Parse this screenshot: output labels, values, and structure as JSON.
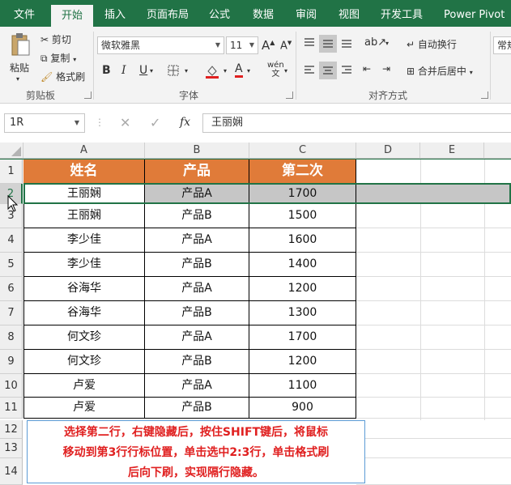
{
  "tabs": [
    "文件",
    "开始",
    "插入",
    "页面布局",
    "公式",
    "数据",
    "审阅",
    "视图",
    "开发工具",
    "Power Pivot"
  ],
  "ribbon": {
    "clipboard": {
      "paste": "粘贴",
      "cut": "剪切",
      "copy": "复制",
      "format_painter": "格式刷",
      "group": "剪贴板"
    },
    "font": {
      "name": "微软雅黑",
      "size": "11",
      "bold": "B",
      "italic": "I",
      "underline": "U",
      "grow": "A",
      "shrink": "A",
      "phonetic": "wén",
      "group": "字体"
    },
    "alignment": {
      "wrap": "自动换行",
      "merge": "合并后居中",
      "group": "对齐方式"
    },
    "number": {
      "format": "常规"
    }
  },
  "formula_bar": {
    "name_box": "1R",
    "fx": "fx",
    "value": "王丽娴"
  },
  "columns": [
    "A",
    "B",
    "C",
    "D",
    "E"
  ],
  "rows": [
    "1",
    "2",
    "3",
    "4",
    "5",
    "6",
    "7",
    "8",
    "9",
    "10",
    "11",
    "12",
    "13",
    "14"
  ],
  "table": {
    "headers": [
      "姓名",
      "产品",
      "第二次"
    ],
    "data": [
      [
        "王丽娴",
        "产品A",
        "1700"
      ],
      [
        "王丽娴",
        "产品B",
        "1500"
      ],
      [
        "李少佳",
        "产品A",
        "1600"
      ],
      [
        "李少佳",
        "产品B",
        "1400"
      ],
      [
        "谷海华",
        "产品A",
        "1200"
      ],
      [
        "谷海华",
        "产品B",
        "1300"
      ],
      [
        "何文珍",
        "产品A",
        "1700"
      ],
      [
        "何文珍",
        "产品B",
        "1200"
      ],
      [
        "卢爱",
        "产品A",
        "1100"
      ],
      [
        "卢爱",
        "产品B",
        "900"
      ]
    ]
  },
  "note": {
    "line1": "选择第二行，右键隐藏后，按住SHIFT键后，将鼠标",
    "line2": "移动到第3行行标位置，单击选中2:3行，单击格式刷",
    "line3": "后向下刷，实现隔行隐藏。"
  },
  "colors": {
    "excel_green": "#217346",
    "header_orange": "#e07b39",
    "note_red": "#e02020"
  }
}
